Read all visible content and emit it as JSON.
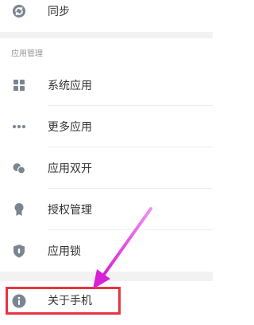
{
  "colors": {
    "icon": "#7a8591",
    "highlight": "#e8343f",
    "arrow": "#e040e0"
  },
  "sync": {
    "label": "同步",
    "icon": "sync-icon"
  },
  "app_management": {
    "header": "应用管理",
    "items": [
      {
        "label": "系统应用",
        "icon": "grid-icon"
      },
      {
        "label": "更多应用",
        "icon": "more-dots-icon"
      },
      {
        "label": "应用双开",
        "icon": "dual-app-icon"
      },
      {
        "label": "授权管理",
        "icon": "authorization-icon"
      },
      {
        "label": "应用锁",
        "icon": "shield-lock-icon"
      }
    ]
  },
  "about": {
    "label": "关于手机",
    "icon": "info-icon"
  }
}
